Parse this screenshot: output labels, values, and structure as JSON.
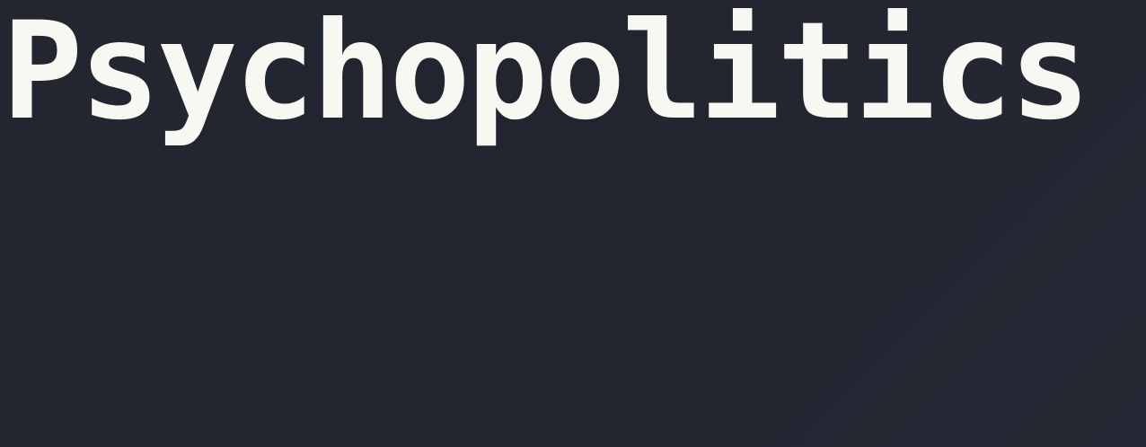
{
  "page": {
    "title": "Psychopolitics"
  },
  "colors": {
    "background": "#23262f",
    "title_text": "#f7f8f2"
  }
}
